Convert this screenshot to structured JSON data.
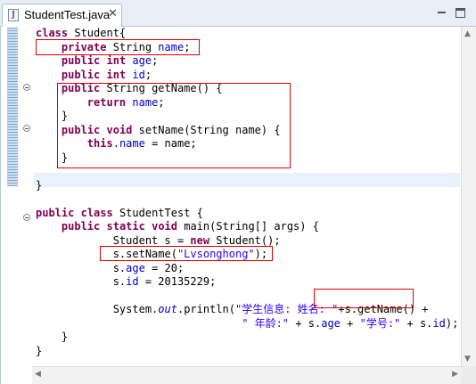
{
  "tab": {
    "title": "StudentTest.java",
    "close_glyph": "✕",
    "icon": "java-file-icon"
  },
  "window_controls": {
    "minimize_icon": "minimize-icon",
    "maximize_icon": "maximize-icon"
  },
  "colors": {
    "keyword": "#7f0055",
    "field": "#0000c0",
    "string": "#2a00ff",
    "highlight_box": "#e00000",
    "current_line": "#e8f2fe"
  },
  "code_lines": [
    [
      {
        "t": "class",
        "c": "kw"
      },
      {
        "t": " Student{"
      }
    ],
    [
      {
        "t": "    "
      },
      {
        "t": "private",
        "c": "kw"
      },
      {
        "t": " String "
      },
      {
        "t": "name",
        "c": "fld"
      },
      {
        "t": ";"
      }
    ],
    [
      {
        "t": "    "
      },
      {
        "t": "public",
        "c": "kw"
      },
      {
        "t": " "
      },
      {
        "t": "int",
        "c": "kw"
      },
      {
        "t": " "
      },
      {
        "t": "age",
        "c": "fld"
      },
      {
        "t": ";"
      }
    ],
    [
      {
        "t": "    "
      },
      {
        "t": "public",
        "c": "kw"
      },
      {
        "t": " "
      },
      {
        "t": "int",
        "c": "kw"
      },
      {
        "t": " "
      },
      {
        "t": "id",
        "c": "fld"
      },
      {
        "t": ";"
      }
    ],
    [
      {
        "t": "    "
      },
      {
        "t": "public",
        "c": "kw"
      },
      {
        "t": " String getName() {"
      }
    ],
    [
      {
        "t": "        "
      },
      {
        "t": "return",
        "c": "kw"
      },
      {
        "t": " "
      },
      {
        "t": "name",
        "c": "fld"
      },
      {
        "t": ";"
      }
    ],
    [
      {
        "t": "    }"
      }
    ],
    [
      {
        "t": "    "
      },
      {
        "t": "public",
        "c": "kw"
      },
      {
        "t": " "
      },
      {
        "t": "void",
        "c": "kw"
      },
      {
        "t": " setName(String name) {"
      }
    ],
    [
      {
        "t": "        "
      },
      {
        "t": "this",
        "c": "kw"
      },
      {
        "t": "."
      },
      {
        "t": "name",
        "c": "fld"
      },
      {
        "t": " = name;"
      }
    ],
    [
      {
        "t": "    }"
      }
    ],
    [
      {
        "t": ""
      }
    ],
    [
      {
        "t": "}"
      }
    ],
    [
      {
        "t": ""
      }
    ],
    [
      {
        "t": "public",
        "c": "kw"
      },
      {
        "t": " "
      },
      {
        "t": "class",
        "c": "kw"
      },
      {
        "t": " StudentTest {"
      }
    ],
    [
      {
        "t": "    "
      },
      {
        "t": "public",
        "c": "kw"
      },
      {
        "t": " "
      },
      {
        "t": "static",
        "c": "kw"
      },
      {
        "t": " "
      },
      {
        "t": "void",
        "c": "kw"
      },
      {
        "t": " main(String[] args) {"
      }
    ],
    [
      {
        "t": "            Student s = "
      },
      {
        "t": "new",
        "c": "kw"
      },
      {
        "t": " Student();"
      }
    ],
    [
      {
        "t": "            s.setName("
      },
      {
        "t": "\"Lvsonghong\"",
        "c": "str"
      },
      {
        "t": ");"
      }
    ],
    [
      {
        "t": "            s."
      },
      {
        "t": "age",
        "c": "fld"
      },
      {
        "t": " = 20;"
      }
    ],
    [
      {
        "t": "            s."
      },
      {
        "t": "id",
        "c": "fld"
      },
      {
        "t": " = 20135229;"
      }
    ],
    [
      {
        "t": ""
      }
    ],
    [
      {
        "t": "            System."
      },
      {
        "t": "out",
        "c": "st"
      },
      {
        "t": ".println("
      },
      {
        "t": "\"学生信息: 姓名: \"",
        "c": "str"
      },
      {
        "t": "+s.getName() +"
      }
    ],
    [
      {
        "t": "                                "
      },
      {
        "t": "\" 年龄:\"",
        "c": "str"
      },
      {
        "t": " + s."
      },
      {
        "t": "age",
        "c": "fld"
      },
      {
        "t": " + "
      },
      {
        "t": "\"学号:\"",
        "c": "str"
      },
      {
        "t": " + s."
      },
      {
        "t": "id",
        "c": "fld"
      },
      {
        "t": ");"
      }
    ],
    [
      {
        "t": "    }"
      }
    ],
    [
      {
        "t": "}"
      }
    ]
  ]
}
